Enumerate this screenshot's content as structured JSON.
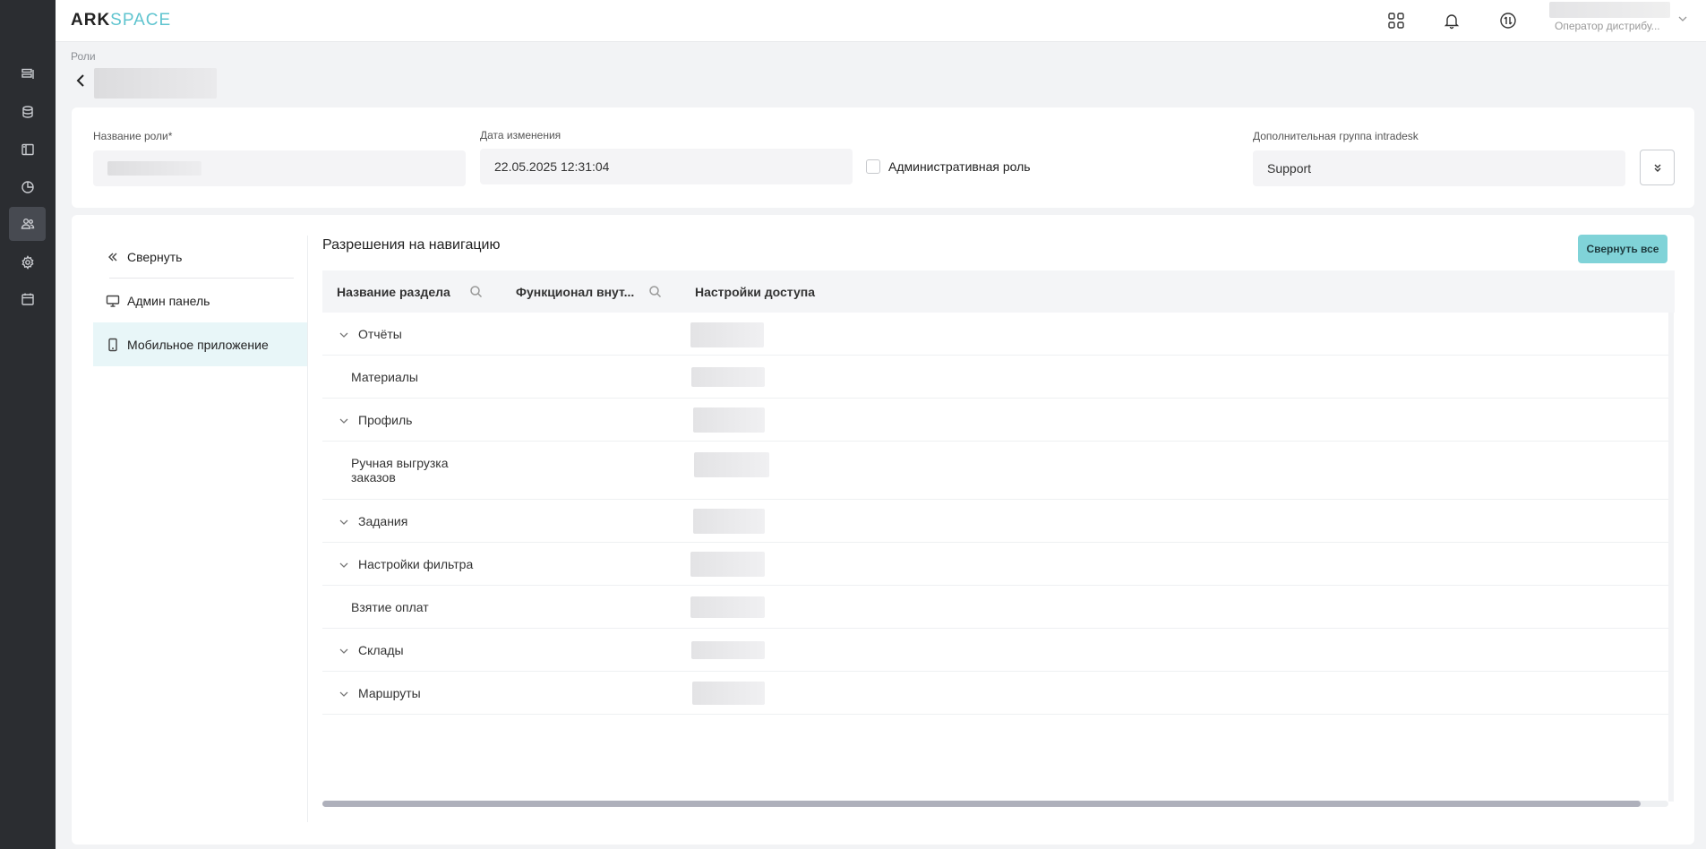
{
  "app": {
    "logo_part1": "ARK",
    "logo_part2": "SPACE"
  },
  "rail": {
    "items": [
      {
        "name": "list-icon"
      },
      {
        "name": "database-icon"
      },
      {
        "name": "layout-icon"
      },
      {
        "name": "chart-icon"
      },
      {
        "name": "users-icon",
        "active": true
      },
      {
        "name": "gear-icon"
      },
      {
        "name": "calendar-icon"
      }
    ]
  },
  "header": {
    "user_role": "Оператор дистрибу..."
  },
  "breadcrumb": {
    "label": "Роли"
  },
  "form": {
    "role_name_label": "Название роли*",
    "modified_label": "Дата изменения",
    "modified_value": "22.05.2025 12:31:04",
    "admin_role_label": "Административная роль",
    "admin_role_checked": false,
    "group_label": "Дополнительная группа intradesk",
    "group_value": "Support"
  },
  "sidebar": {
    "collapse_label": "Свернуть",
    "items": [
      {
        "label": "Админ панель",
        "icon": "monitor-icon"
      },
      {
        "label": "Мобильное приложение",
        "icon": "mobile-icon",
        "selected": true
      }
    ]
  },
  "permissions": {
    "title": "Разрешения на навигацию",
    "collapse_all_label": "Свернуть все",
    "columns": [
      "Название раздела",
      "Функционал внут...",
      "Настройки доступа"
    ],
    "rows": [
      {
        "label": "Отчёты",
        "expandable": true
      },
      {
        "label": "Материалы",
        "expandable": false
      },
      {
        "label": "Профиль",
        "expandable": true
      },
      {
        "label": "Ручная выгрузка заказов",
        "expandable": false
      },
      {
        "label": "Задания",
        "expandable": true
      },
      {
        "label": "Настройки фильтра",
        "expandable": true
      },
      {
        "label": "Взятие оплат",
        "expandable": false
      },
      {
        "label": "Склады",
        "expandable": true
      },
      {
        "label": "Маршруты",
        "expandable": true
      }
    ]
  },
  "colors": {
    "accent": "#80d3d8",
    "logo_accent": "#5fc4cf",
    "rail_bg": "#2b2d31",
    "selected_bg": "#e8f6f8"
  }
}
